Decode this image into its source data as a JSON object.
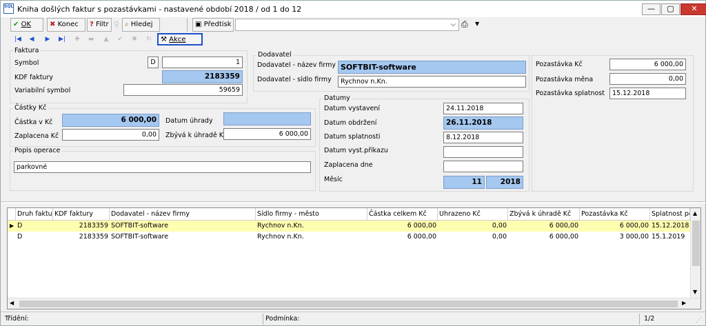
{
  "window": {
    "title": "Kniha došlých faktur s pozastávkami - nastavené období 2018 / od 1 do 12",
    "app_icon_text": "SQL",
    "minimize": "▭",
    "restore": "▢",
    "close": "✕"
  },
  "toolbar": {
    "ok": "OK",
    "konec": "Konec",
    "filtr": "Filtr",
    "hledej": "Hledej",
    "predtisk": "Předtisk",
    "akce": "Akce"
  },
  "faktura": {
    "group": "Faktura",
    "symbol_label": "Symbol",
    "symbol_type": "D",
    "symbol_value": "1",
    "kdf_label": "KDF faktury",
    "kdf_value": "2183359",
    "vs_label": "Variabilní symbol",
    "vs_value": "59659"
  },
  "castky": {
    "group": "Částky Kč",
    "castka_label": "Částka v Kč",
    "castka_value": "6 000,00",
    "zaplacena_label": "Zaplacena Kč",
    "zaplacena_value": "0,00",
    "datum_uhrady_label": "Datum úhrady",
    "datum_uhrady_value": "",
    "zbyva_label": "Zbývá k úhradě Kč",
    "zbyva_value": "6 000,00"
  },
  "popis": {
    "group": "Popis operace",
    "value": "parkovné"
  },
  "dodavatel": {
    "group": "Dodavatel",
    "nazev_label": "Dodavatel  - název firmy",
    "nazev_value": "SOFTBIT-software",
    "sidlo_label": "Dodavatel  - sídlo firmy",
    "sidlo_value": "Rychnov n.Kn."
  },
  "datumy": {
    "group": "Datumy",
    "vystaveni_label": "Datum vystavení",
    "vystaveni_value": "24.11.2018",
    "obdrzeni_label": "Datum obdržení",
    "obdrzeni_value": "26.11.2018",
    "splatnosti_label": "Datum splatnosti",
    "splatnosti_value": "8.12.2018",
    "vyst_prikazu_label": "Datum vyst.příkazu",
    "vyst_prikazu_value": "",
    "zaplacena_dne_label": "Zaplacena dne",
    "zaplacena_dne_value": "",
    "mesic_label": "Měsíc",
    "mesic_value": "11",
    "rok_value": "2018"
  },
  "pozastavka": {
    "kc_label": "Pozastávka Kč",
    "kc_value": "6 000,00",
    "mena_label": "Pozastávka měna",
    "mena_value": "0,00",
    "splatnost_label": "Pozastávka splatnost",
    "splatnost_value": "15.12.2018"
  },
  "table": {
    "columns": [
      "Druh faktury",
      "KDF faktury",
      "Dodavatel - název firmy",
      "Sídlo firmy - město",
      "Částka celkem Kč",
      "Uhrazeno Kč",
      "Zbývá k úhradě Kč",
      "Pozastávka Kč",
      "Splatnost poz"
    ],
    "rows": [
      [
        "D",
        "2183359",
        "SOFTBIT-software",
        "Rychnov n.Kn.",
        "6 000,00",
        "0,00",
        "6 000,00",
        "6 000,00",
        "15.12.2018"
      ],
      [
        "D",
        "2183359",
        "SOFTBIT-software",
        "Rychnov n.Kn.",
        "6 000,00",
        "0,00",
        "6 000,00",
        "3 000,00",
        "15.1.2019"
      ]
    ],
    "selected_row": 0
  },
  "status": {
    "trideni": "Třídění:",
    "podminka": "Podmínka:",
    "page": "1/2"
  },
  "colors": {
    "selected_row": "#fefeb0",
    "highlight_field": "#a5c8f0"
  }
}
